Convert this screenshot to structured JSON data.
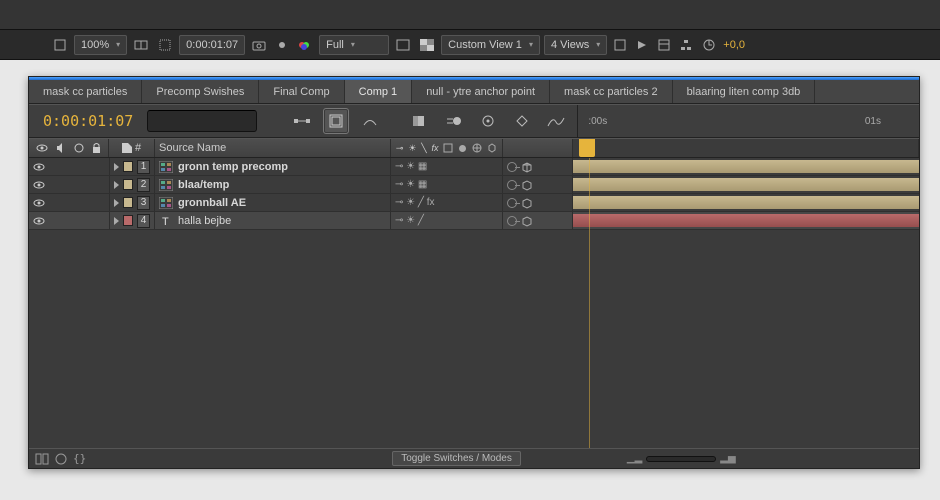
{
  "viewer": {
    "zoom": "100%",
    "timecode": "0:00:01:07",
    "quality": "Full",
    "view_mode": "Custom View 1",
    "views_count": "4 Views",
    "exposure": "+0,0"
  },
  "tabs": [
    {
      "label": "mask cc particles",
      "active": false
    },
    {
      "label": "Precomp Swishes",
      "active": false
    },
    {
      "label": "Final Comp",
      "active": false
    },
    {
      "label": "Comp 1",
      "active": true
    },
    {
      "label": "null - ytre anchor point",
      "active": false
    },
    {
      "label": "mask cc particles 2",
      "active": false
    },
    {
      "label": "blaaring liten comp 3db",
      "active": false
    }
  ],
  "timeline": {
    "current_time": "0:00:01:07",
    "search_placeholder": "",
    "ruler": {
      "start_label": ":00s",
      "mid_label": "01s"
    }
  },
  "columns": {
    "number_header": "#",
    "source_header": "Source Name"
  },
  "layers": [
    {
      "num": "1",
      "name": "gronn temp precomp",
      "label_color": "#c7b88f",
      "icon": "comp",
      "mods": "⊸ ☀ ▦",
      "fx": "",
      "bar": "tan",
      "has3d": true
    },
    {
      "num": "2",
      "name": "blaa/temp",
      "label_color": "#c7b88f",
      "icon": "comp",
      "mods": "⊸ ☀ ▦",
      "fx": "",
      "bar": "tan",
      "has3d": true
    },
    {
      "num": "3",
      "name": "gronnball AE",
      "label_color": "#c7b88f",
      "icon": "comp",
      "mods": "⊸ ☀ ╱ fx",
      "fx": "fx",
      "bar": "tan",
      "has3d": true
    },
    {
      "num": "4",
      "name": "halla bejbe",
      "label_color": "#b96a6a",
      "icon": "text",
      "mods": "⊸ ☀ ╱",
      "fx": "",
      "bar": "red",
      "has3d": true
    }
  ],
  "footer": {
    "toggle_label": "Toggle Switches / Modes"
  },
  "colors": {
    "accent": "#e6b43c",
    "panel": "#3e3e3e"
  }
}
